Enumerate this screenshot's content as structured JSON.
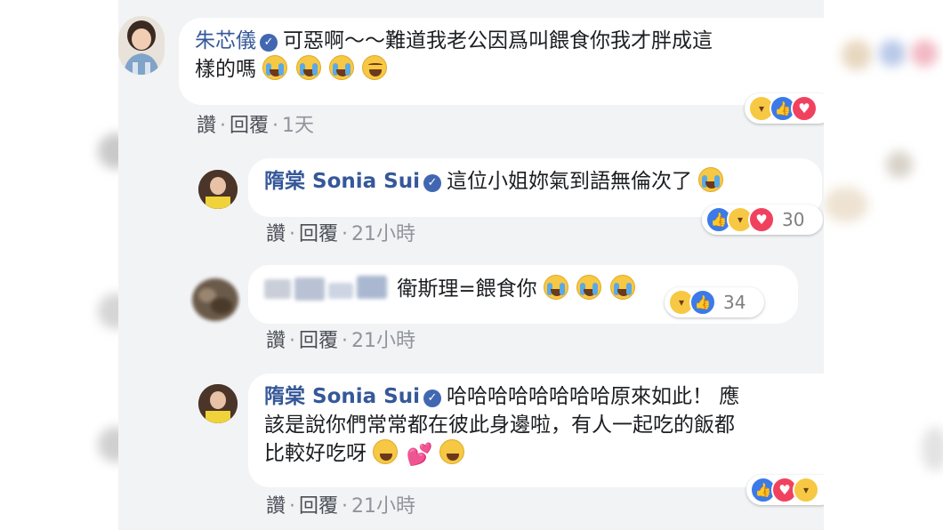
{
  "comments": [
    {
      "author": "朱芯儀",
      "text": "可惡啊～～難道我老公因爲叫餵食你我才胖成這",
      "text_line2": "樣的嗎",
      "actions": {
        "like": "讚",
        "reply": "回覆",
        "time": "1天"
      }
    },
    {
      "author": "隋棠 Sonia Sui",
      "text": "這位小姐妳氣到語無倫次了",
      "reaction_count": "30",
      "actions": {
        "like": "讚",
        "reply": "回覆",
        "time": "21小時"
      }
    },
    {
      "author": "",
      "text": "衛斯理=餵食你",
      "reaction_count": "34",
      "actions": {
        "like": "讚",
        "reply": "回覆",
        "time": "21小時"
      }
    },
    {
      "author": "隋棠 Sonia Sui",
      "text_line1": "哈哈哈哈哈哈哈哈原來如此！ 應",
      "text_line2": "該是說你們常常都在彼此身邊啦，有人一起吃的飯都",
      "text_line3": "比較好吃呀",
      "actions": {
        "like": "讚",
        "reply": "回覆",
        "time": "21小時"
      }
    }
  ],
  "colors": {
    "panel_bg": "#f2f3f5",
    "name": "#365899",
    "verified": "#4267b2",
    "like": "#3b7ae8",
    "love": "#f0425f",
    "haha": "#f7c843"
  }
}
